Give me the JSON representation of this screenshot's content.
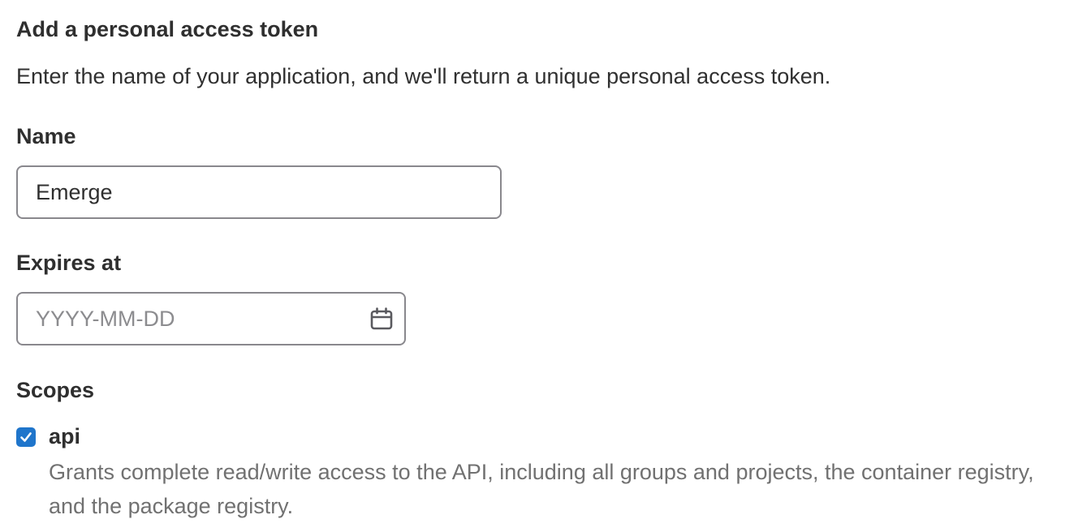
{
  "form": {
    "heading": "Add a personal access token",
    "description": "Enter the name of your application, and we'll return a unique personal access token.",
    "name_label": "Name",
    "name_value": "Emerge",
    "expires_label": "Expires at",
    "expires_placeholder": "YYYY-MM-DD",
    "expires_icon": "calendar-icon",
    "scopes_label": "Scopes",
    "scopes": [
      {
        "name": "api",
        "checked": true,
        "description": "Grants complete read/write access to the API, including all groups and projects, the container registry, and the package registry."
      }
    ]
  },
  "colors": {
    "checkbox_accent": "#1f75cb",
    "input_border": "#89888d",
    "muted_text": "#717171"
  }
}
